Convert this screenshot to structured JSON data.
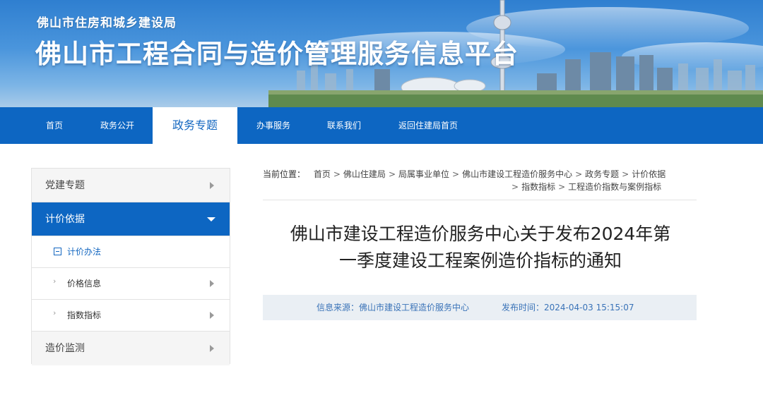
{
  "header": {
    "org_name": "佛山市住房和城乡建设局",
    "site_title": "佛山市工程合同与造价管理服务信息平台"
  },
  "nav": {
    "items": [
      {
        "label": "首页"
      },
      {
        "label": "政务公开"
      },
      {
        "label": "政务专题",
        "active": true
      },
      {
        "label": "办事服务"
      },
      {
        "label": "联系我们"
      },
      {
        "label": "返回住建局首页"
      }
    ]
  },
  "sidebar": {
    "items": [
      {
        "label": "党建专题"
      },
      {
        "label": "计价依据",
        "active": true
      },
      {
        "label": "计价办法",
        "current": true
      },
      {
        "label": "价格信息"
      },
      {
        "label": "指数指标"
      },
      {
        "label": "造价监测"
      }
    ]
  },
  "breadcrumb": {
    "label": "当前位置：",
    "items": [
      "首页",
      "佛山住建局",
      "局属事业单位",
      "佛山市建设工程造价服务中心",
      "政务专题",
      "计价依据",
      "指数指标",
      "工程造价指数与案例指标"
    ],
    "separator": ">"
  },
  "article": {
    "title_line1": "佛山市建设工程造价服务中心关于发布2024年第",
    "title_line2": "一季度建设工程案例造价指标的通知",
    "source_label": "信息来源：",
    "source": "佛山市建设工程造价服务中心",
    "time_label": "发布时间：",
    "time": "2024-04-03 15:15:07"
  },
  "colors": {
    "primary": "#0d66c2",
    "meta_bg": "#eaeff4",
    "meta_text": "#3a73b8"
  }
}
